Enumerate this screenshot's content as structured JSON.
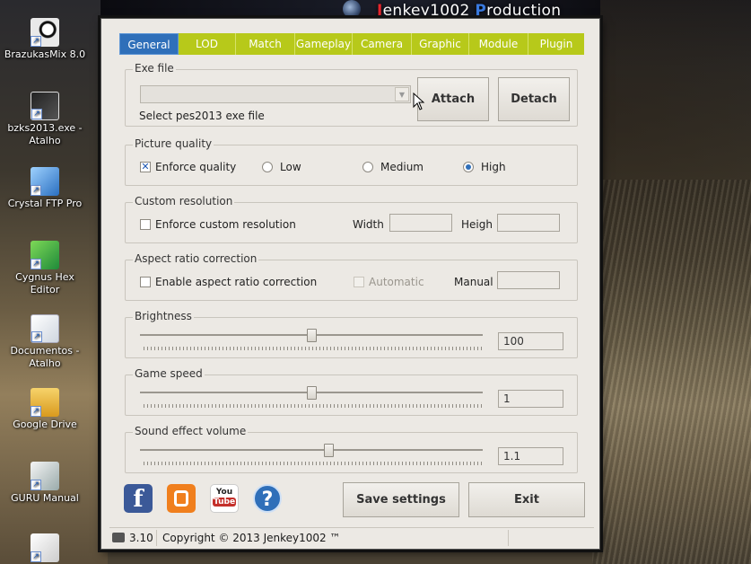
{
  "window_title": {
    "prefix_letter": "J",
    "part1": "enkey1002 ",
    "accent_letter": "P",
    "part2": "roduction"
  },
  "tabs": [
    {
      "label": "General",
      "active": true
    },
    {
      "label": "LOD",
      "active": false
    },
    {
      "label": "Match",
      "active": false
    },
    {
      "label": "Gameplay",
      "active": false
    },
    {
      "label": "Camera",
      "active": false
    },
    {
      "label": "Graphic",
      "active": false
    },
    {
      "label": "Module",
      "active": false
    },
    {
      "label": "Plugin",
      "active": false
    }
  ],
  "exe_file": {
    "label": "Exe file",
    "combo_value": "",
    "hint": "Select pes2013 exe file",
    "attach_label": "Attach",
    "detach_label": "Detach"
  },
  "picture_quality": {
    "label": "Picture quality",
    "enforce_label": "Enforce quality",
    "enforce_checked": true,
    "options": [
      {
        "label": "Low",
        "selected": false
      },
      {
        "label": "Medium",
        "selected": false
      },
      {
        "label": "High",
        "selected": true
      }
    ]
  },
  "custom_resolution": {
    "label": "Custom resolution",
    "enforce_label": "Enforce custom resolution",
    "width_label": "Width",
    "width_value": "",
    "height_label": "Heigh",
    "height_value": ""
  },
  "aspect_ratio": {
    "label": "Aspect ratio correction",
    "enable_label": "Enable aspect ratio correction",
    "automatic_label": "Automatic",
    "manual_label": "Manual",
    "manual_value": ""
  },
  "brightness": {
    "label": "Brightness",
    "value": "100",
    "position": 0.5
  },
  "game_speed": {
    "label": "Game speed",
    "value": "1",
    "position": 0.5
  },
  "sound_volume": {
    "label": "Sound effect volume",
    "value": "1.1",
    "position": 0.55
  },
  "bottom": {
    "save_label": "Save settings",
    "exit_label": "Exit",
    "youtube_label_1": "You",
    "youtube_label_2": "Tube",
    "facebook_glyph": "f",
    "help_glyph": "?"
  },
  "status_bar": {
    "version": "3.10",
    "copyright": "Copyright © 2013 Jenkey1002 ™"
  },
  "desktop_icons": [
    {
      "label": "BrazukasMix 8.0"
    },
    {
      "label": "bzks2013.exe - Atalho"
    },
    {
      "label": "Crystal FTP Pro"
    },
    {
      "label": "Cygnus Hex Editor"
    },
    {
      "label": "Documentos - Atalho"
    },
    {
      "label": "Google Drive"
    },
    {
      "label": "GURU Manual"
    }
  ],
  "colors": {
    "tab_bar": "#b7c91a",
    "tab_active": "#2f6fb9",
    "facebook": "#3b5998",
    "blogger": "#f07f1d",
    "youtube": "#c4302b",
    "help": "#2f6fb9"
  }
}
